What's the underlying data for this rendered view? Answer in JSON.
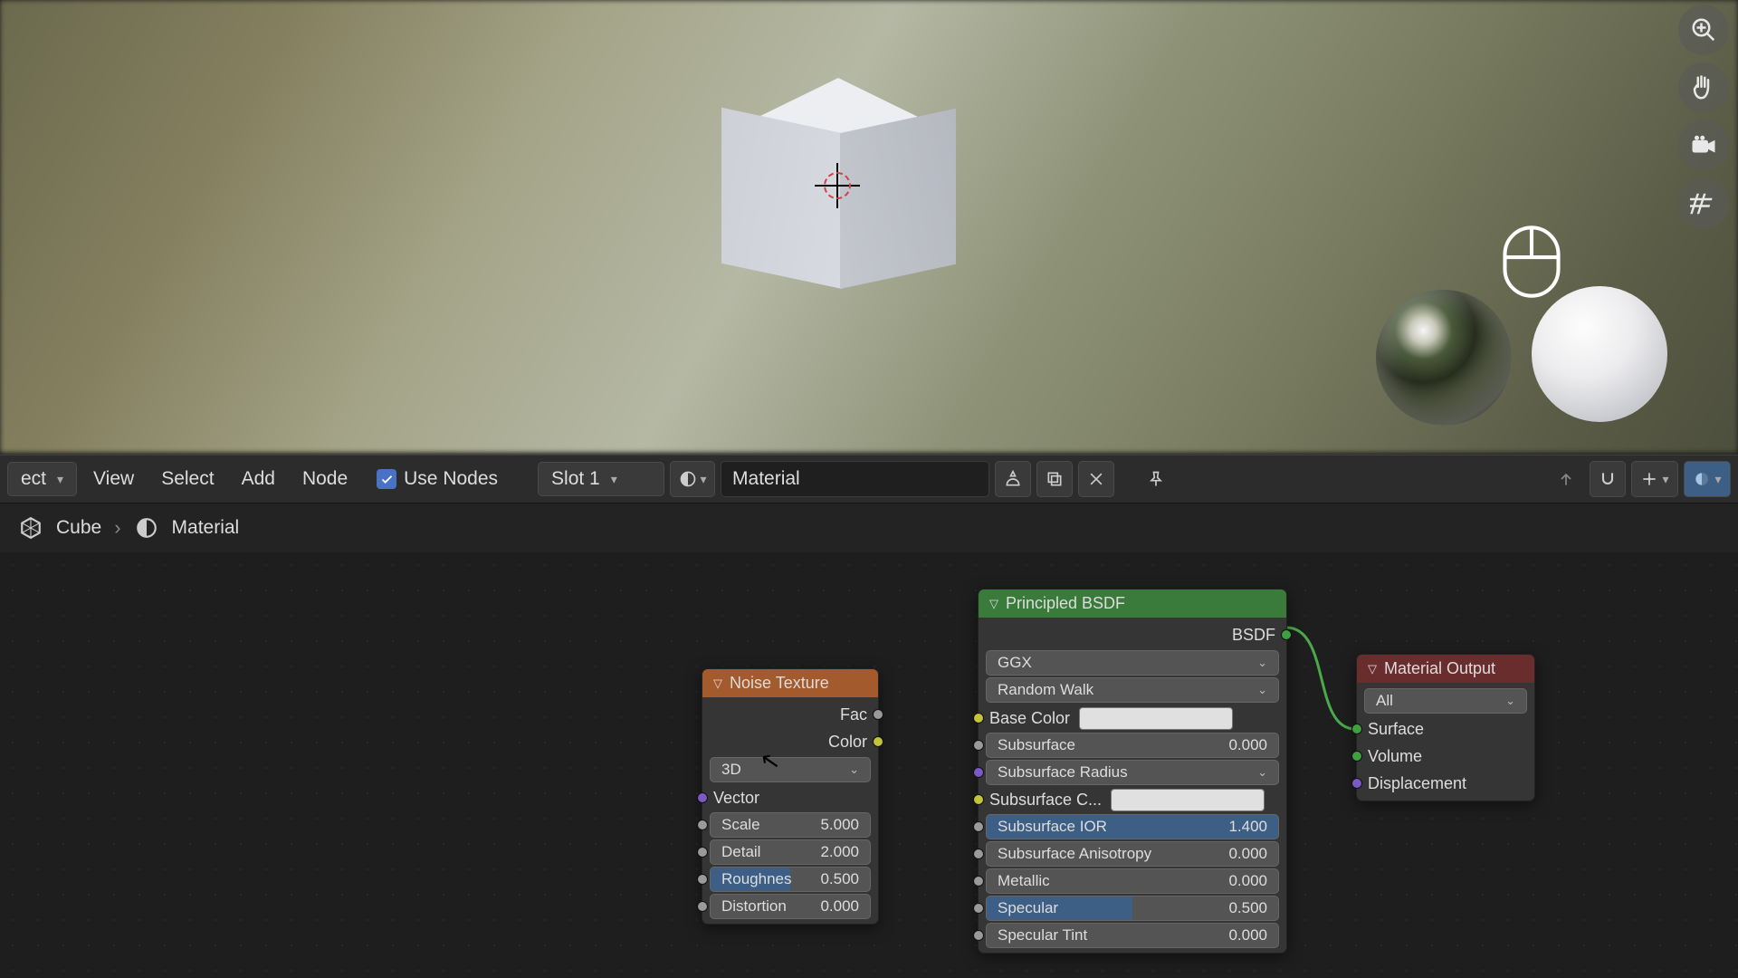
{
  "viewport": {
    "object_name": "Cube"
  },
  "tools": {
    "zoom": "zoom-icon",
    "pan": "pan-icon",
    "camera": "camera-icon",
    "grid": "grid-icon"
  },
  "shader_header": {
    "mode_dropdown": "ect",
    "menu_view": "View",
    "menu_select": "Select",
    "menu_add": "Add",
    "menu_node": "Node",
    "use_nodes_label": "Use Nodes",
    "use_nodes_checked": true,
    "slot": "Slot 1",
    "material_name": "Material"
  },
  "breadcrumb": {
    "object": "Cube",
    "material": "Material"
  },
  "nodes": {
    "noise": {
      "title": "Noise Texture",
      "out_fac": "Fac",
      "out_color": "Color",
      "dim": "3D",
      "in_vector": "Vector",
      "scale_label": "Scale",
      "scale_val": "5.000",
      "detail_label": "Detail",
      "detail_val": "2.000",
      "rough_label": "Roughnes",
      "rough_val": "0.500",
      "dist_label": "Distortion",
      "dist_val": "0.000"
    },
    "bsdf": {
      "title": "Principled BSDF",
      "out_bsdf": "BSDF",
      "distribution": "GGX",
      "subsurf_method": "Random Walk",
      "base_color": "Base Color",
      "subsurface_label": "Subsurface",
      "subsurface_val": "0.000",
      "subsurf_radius": "Subsurface Radius",
      "subsurf_color": "Subsurface C...",
      "subsurf_ior_label": "Subsurface IOR",
      "subsurf_ior_val": "1.400",
      "subsurf_aniso_label": "Subsurface Anisotropy",
      "subsurf_aniso_val": "0.000",
      "metallic_label": "Metallic",
      "metallic_val": "0.000",
      "specular_label": "Specular",
      "specular_val": "0.500",
      "spectint_label": "Specular Tint",
      "spectint_val": "0.000"
    },
    "output": {
      "title": "Material Output",
      "target": "All",
      "surface": "Surface",
      "volume": "Volume",
      "displacement": "Displacement"
    }
  }
}
